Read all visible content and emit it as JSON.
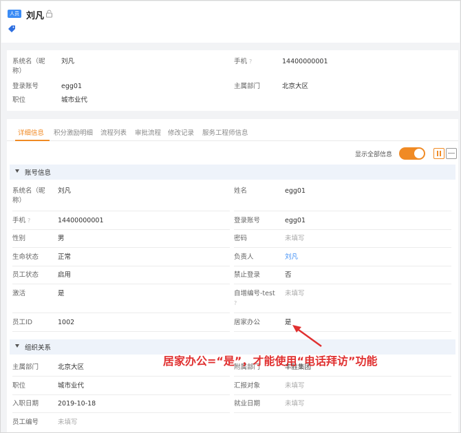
{
  "header": {
    "badge": "人员",
    "name": "刘凡",
    "lock_icon": "lock-icon",
    "label_icon": "tag-icon"
  },
  "summary": {
    "nickname_label": "系统名（昵称）",
    "nickname_value": "刘凡",
    "phone_label": "手机",
    "phone_value": "14400000001",
    "login_label": "登录账号",
    "login_value": "egg01",
    "dept_label": "主属部门",
    "dept_value": "北京大区",
    "position_label": "职位",
    "position_value": "城市业代"
  },
  "tabs": [
    "详细信息",
    "积分激励明细",
    "流程列表",
    "审批流程",
    "修改记录",
    "服务工程师信息"
  ],
  "toolbar": {
    "show_all_label": "显示全部信息"
  },
  "account": {
    "title": "账号信息",
    "nickname_label": "系统名（昵称）",
    "nickname_value": "刘凡",
    "surname_label": "姓名",
    "surname_value": "egg01",
    "phone_label": "手机",
    "phone_value": "14400000001",
    "login_label": "登录账号",
    "login_value": "egg01",
    "gender_label": "性别",
    "gender_value": "男",
    "password_label": "密码",
    "password_value": "未填写",
    "life_label": "生命状态",
    "life_value": "正常",
    "owner_label": "负责人",
    "owner_value": "刘凡",
    "staff_status_label": "员工状态",
    "staff_status_value": "启用",
    "ban_label": "禁止登录",
    "ban_value": "否",
    "activated_label": "激活",
    "activated_value": "是",
    "autonum_label": "自增编号-test",
    "autonum_value": "未填写",
    "staff_id_label": "员工ID",
    "staff_id_value": "1002",
    "home_office_label": "居家办公",
    "home_office_value": "是"
  },
  "org": {
    "title": "组织关系",
    "dept_label": "主属部门",
    "dept_value": "北京大区",
    "sub_dept_label": "附属部门",
    "sub_dept_value": "丰胜集团",
    "position_label": "职位",
    "position_value": "城市业代",
    "report_label": "汇报对象",
    "report_value": "未填写",
    "join_label": "入职日期",
    "join_value": "2019-10-18",
    "employ_label": "就业日期",
    "employ_value": "未填写",
    "staff_no_label": "员工编号",
    "staff_no_value": "未填写"
  },
  "annotation": {
    "text": "居家办公=“是”，才能使用“电话拜访”功能",
    "color": "#e03030"
  },
  "colors": {
    "accent": "#f08a24",
    "link": "#3b8cf5"
  }
}
